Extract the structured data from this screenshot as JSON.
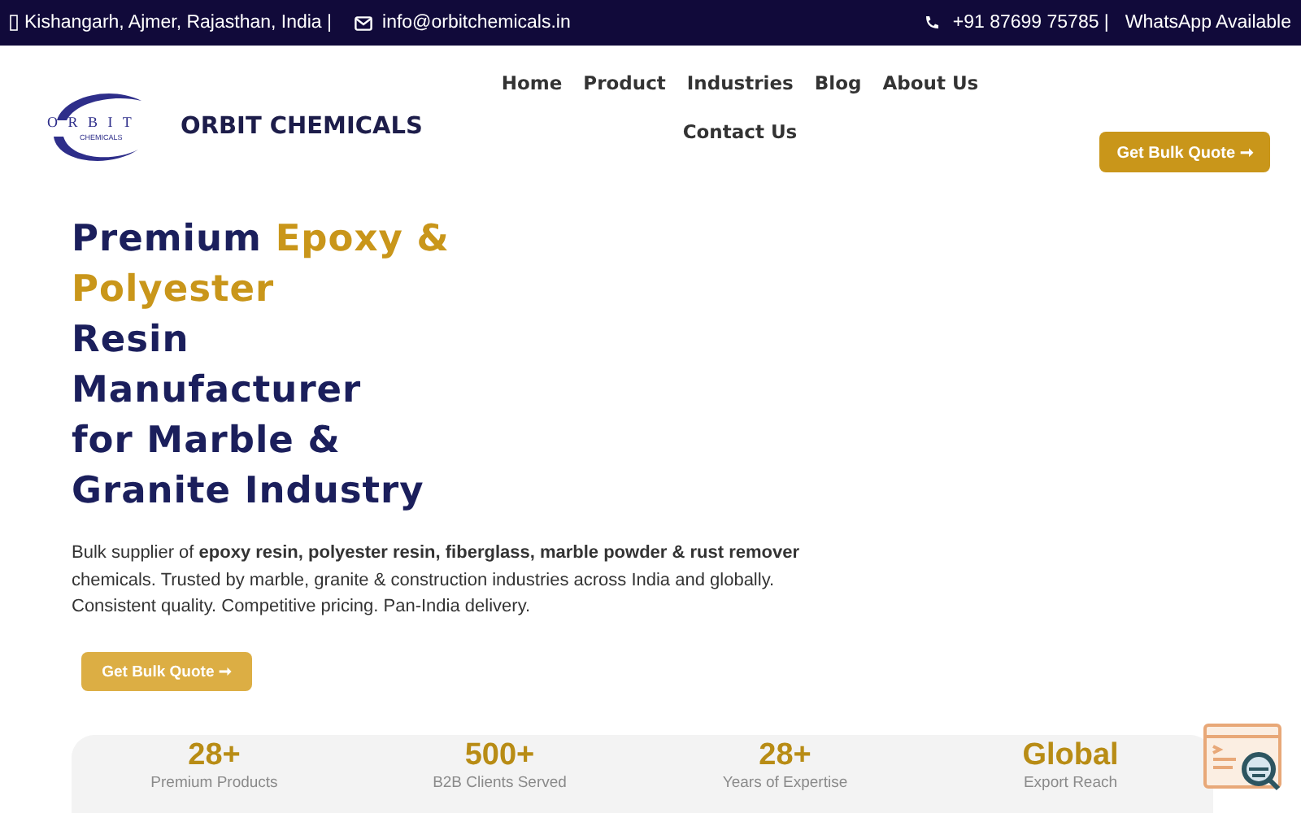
{
  "top_bar": {
    "location": "Kishangarh, Ajmer, Rajasthan, India |",
    "email": "info@orbitchemicals.in",
    "phone": "+91 87699 75785 |",
    "whatsapp": "WhatsApp Available"
  },
  "logo": {
    "letters": "O R B I T",
    "sub": "CHEMICALS",
    "name": "ORBIT CHEMICALS"
  },
  "nav": [
    "Home",
    "Product",
    "Industries",
    "Blog",
    "About Us",
    "Contact Us"
  ],
  "header_button": "Get Bulk Quote ➞",
  "headline": [
    [
      {
        "text": "Premium ",
        "accent": false
      },
      {
        "text": "Epoxy &",
        "accent": true
      }
    ],
    [
      {
        "text": "Polyester",
        "accent": true
      }
    ],
    [
      {
        "text": "Resin",
        "accent": false
      }
    ],
    [
      {
        "text": "Manufacturer",
        "accent": false
      }
    ],
    [
      {
        "text": "for Marble &",
        "accent": false
      }
    ],
    [
      {
        "text": "Granite Industry",
        "accent": false
      }
    ]
  ],
  "intro": "Bulk supplier of **epoxy resin, polyester resin, fiberglass, marble powder & rust remover** chemicals. Trusted by marble, granite & construction industries across India and globally. Consistent quality. Competitive pricing. Pan-India delivery.",
  "hero_button": "Get Bulk Quote ➞",
  "stats": [
    {
      "value": "28+",
      "label": "Premium Products"
    },
    {
      "value": "500+",
      "label": "B2B Clients Served"
    },
    {
      "value": "28+",
      "label": "Years of Expertise"
    },
    {
      "value": "Global",
      "label": "Export Reach"
    }
  ]
}
